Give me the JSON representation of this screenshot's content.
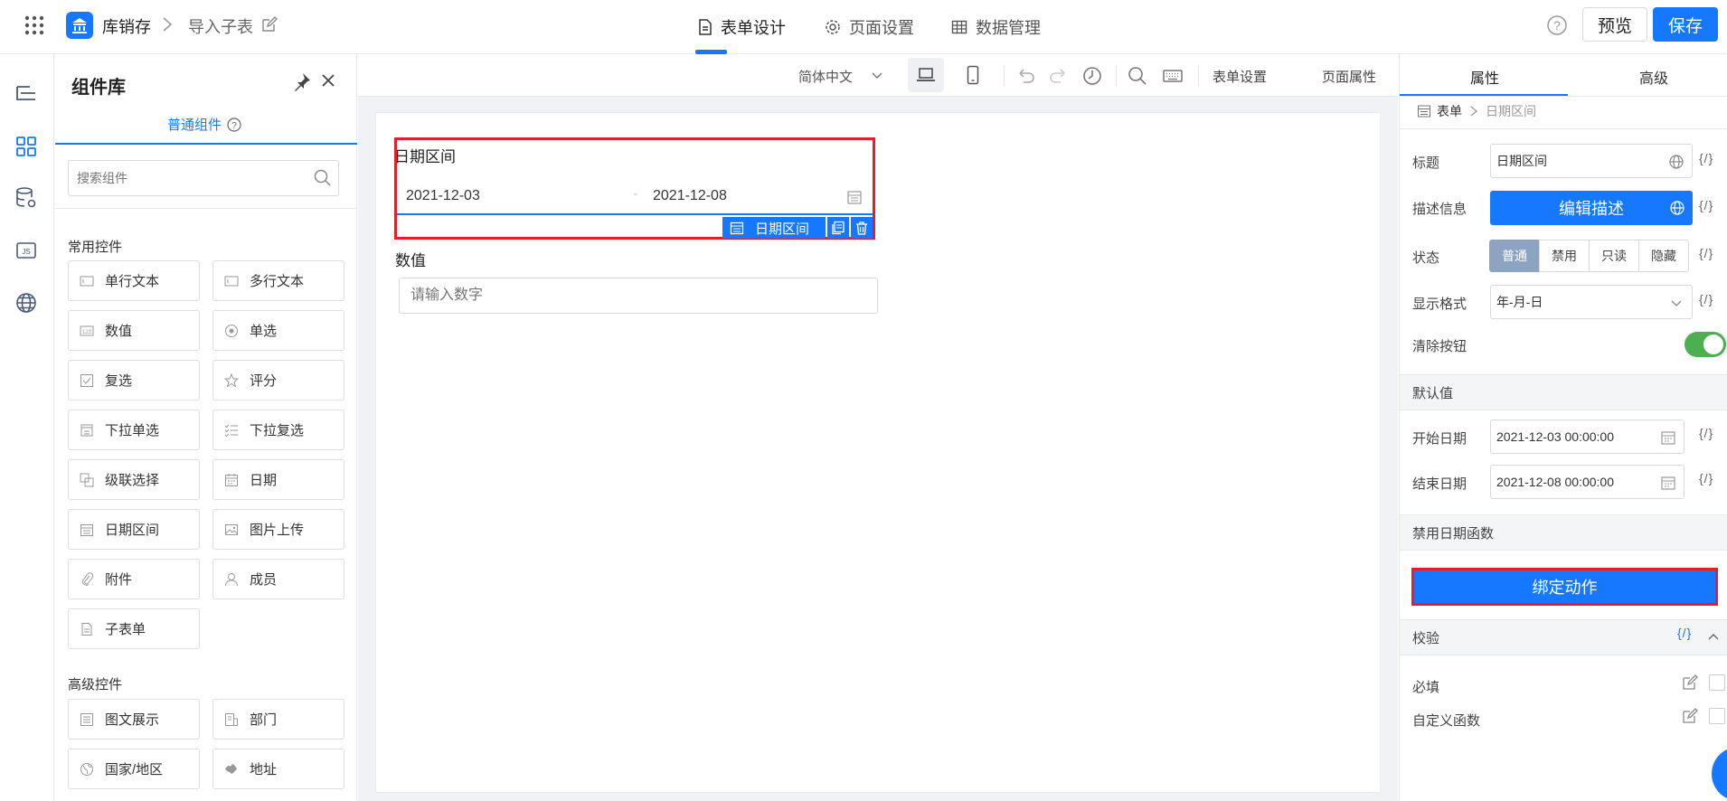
{
  "app": {
    "name": "库销存",
    "subpage": "导入子表"
  },
  "main_tabs": [
    {
      "label": "表单设计",
      "icon": "document-icon",
      "active": true
    },
    {
      "label": "页面设置",
      "icon": "gear-icon",
      "active": false
    },
    {
      "label": "数据管理",
      "icon": "table-icon",
      "active": false
    }
  ],
  "header_actions": {
    "preview": "预览",
    "save": "保存"
  },
  "colors": {
    "primary": "#1677ff",
    "highlight_border": "#e0212b",
    "toggle_on": "#4cb050",
    "status_selected": "#8ca3c2"
  },
  "component_panel": {
    "title": "组件库",
    "sub_tab": "普通组件",
    "search_placeholder": "搜索组件",
    "groups": [
      {
        "label": "常用控件",
        "items": [
          {
            "label": "单行文本",
            "icon": "single-line-text-icon"
          },
          {
            "label": "多行文本",
            "icon": "multi-line-text-icon"
          },
          {
            "label": "数值",
            "icon": "number-icon"
          },
          {
            "label": "单选",
            "icon": "radio-icon"
          },
          {
            "label": "复选",
            "icon": "checkbox-icon"
          },
          {
            "label": "评分",
            "icon": "star-icon"
          },
          {
            "label": "下拉单选",
            "icon": "dropdown-icon"
          },
          {
            "label": "下拉复选",
            "icon": "dropdown-multi-icon"
          },
          {
            "label": "级联选择",
            "icon": "cascade-icon"
          },
          {
            "label": "日期",
            "icon": "calendar-icon"
          },
          {
            "label": "日期区间",
            "icon": "date-range-icon"
          },
          {
            "label": "图片上传",
            "icon": "image-icon"
          },
          {
            "label": "附件",
            "icon": "paperclip-icon"
          },
          {
            "label": "成员",
            "icon": "user-icon"
          },
          {
            "label": "子表单",
            "icon": "subform-icon"
          }
        ]
      },
      {
        "label": "高级控件",
        "items": [
          {
            "label": "图文展示",
            "icon": "richtext-icon"
          },
          {
            "label": "部门",
            "icon": "department-icon"
          },
          {
            "label": "国家/地区",
            "icon": "globe-icon"
          },
          {
            "label": "地址",
            "icon": "address-icon"
          }
        ]
      }
    ]
  },
  "canvas_toolbar": {
    "language": "简体中文",
    "form_settings": "表单设置",
    "page_properties": "页面属性"
  },
  "form": {
    "date_range_field": {
      "label": "日期区间",
      "start": "2021-12-03",
      "separator": "-",
      "end": "2021-12-08",
      "tag": "日期区间"
    },
    "number_field": {
      "label": "数值",
      "placeholder": "请输入数字"
    }
  },
  "properties": {
    "tabs": [
      "属性",
      "高级"
    ],
    "breadcrumb": [
      "表单",
      "日期区间"
    ],
    "title_label": "标题",
    "title_value": "日期区间",
    "desc_label": "描述信息",
    "desc_button": "编辑描述",
    "status_label": "状态",
    "status_options": [
      "普通",
      "禁用",
      "只读",
      "隐藏"
    ],
    "status_selected": "普通",
    "format_label": "显示格式",
    "format_value": "年-月-日",
    "clear_label": "清除按钮",
    "clear_enabled": true,
    "default_section": "默认值",
    "start_label": "开始日期",
    "start_value": "2021-12-03 00:00:00",
    "end_label": "结束日期",
    "end_value": "2021-12-08 00:00:00",
    "disable_section": "禁用日期函数",
    "bind_button": "绑定动作",
    "validate_section": "校验",
    "required_label": "必填",
    "custom_fn_label": "自定义函数",
    "expr_text": "{/}"
  }
}
